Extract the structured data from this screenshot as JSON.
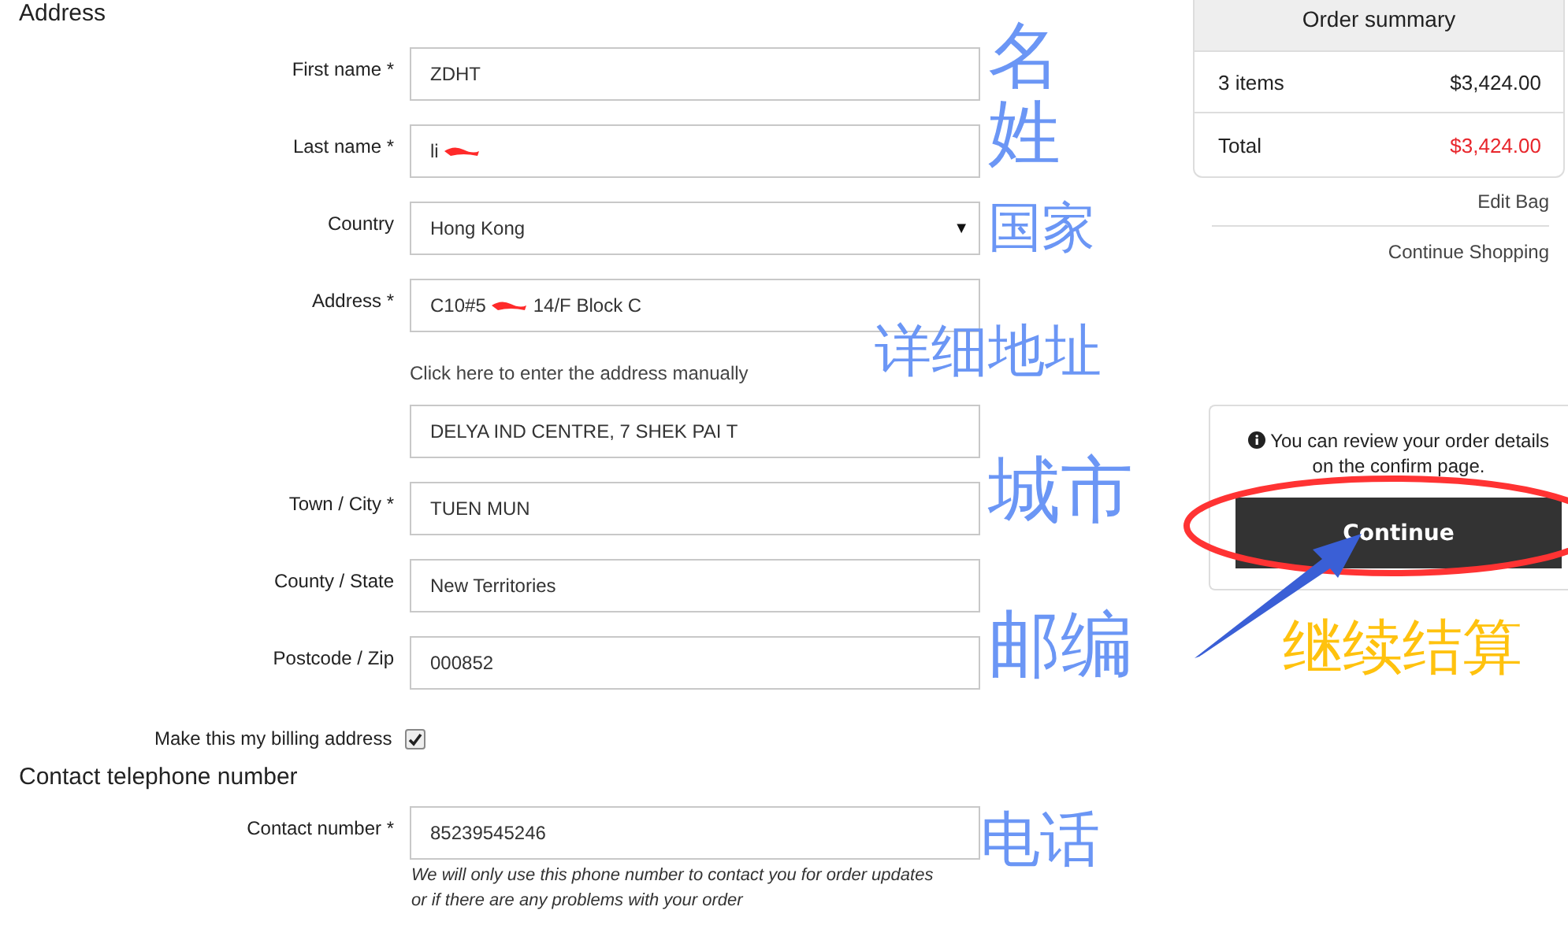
{
  "address_section": {
    "heading": "Address",
    "rows": [
      {
        "kind": "input",
        "label": "First name *",
        "segments": [
          {
            "kind": "text",
            "text": "ZDHT"
          }
        ],
        "note": "名"
      },
      {
        "kind": "input",
        "label": "Last name *",
        "segments": [
          {
            "kind": "text",
            "text": "li"
          },
          {
            "kind": "redaction"
          }
        ],
        "note": "姓"
      },
      {
        "kind": "select",
        "label": "Country",
        "segments": [
          {
            "kind": "text",
            "text": "Hong Kong"
          }
        ],
        "caret": "▼",
        "note": "国家"
      },
      {
        "kind": "input",
        "label": "Address *",
        "segments": [
          {
            "kind": "text",
            "text": "C10#5"
          },
          {
            "kind": "redaction"
          },
          {
            "kind": "text",
            "text": "14/F Block C"
          }
        ]
      },
      {
        "kind": "link",
        "text": "Click here to enter the address manually",
        "note": "详细地址"
      },
      {
        "kind": "input",
        "label": "",
        "segments": [
          {
            "kind": "text",
            "text": "DELYA IND CENTRE, 7 SHEK PAI T"
          }
        ]
      },
      {
        "kind": "input",
        "label": "Town / City *",
        "segments": [
          {
            "kind": "text",
            "text": "TUEN MUN"
          }
        ],
        "note": "城市"
      },
      {
        "kind": "input",
        "label": "County / State",
        "segments": [
          {
            "kind": "text",
            "text": "New Territories"
          }
        ]
      },
      {
        "kind": "input",
        "label": "Postcode / Zip",
        "segments": [
          {
            "kind": "text",
            "text": "000852"
          }
        ],
        "note": "邮编"
      },
      {
        "kind": "checkbox",
        "label": "Make this my billing address",
        "checked": true
      }
    ]
  },
  "contact_section": {
    "heading": "Contact telephone number",
    "label": "Contact number *",
    "value": "85239545246",
    "note": "电话",
    "help": "We will only use this phone number to contact you for order updates or if there are any problems with your order"
  },
  "order_summary": {
    "title": "Order summary",
    "rows": [
      {
        "kind": "subtotal",
        "label": "3 items",
        "amount": "$3,424.00"
      },
      {
        "kind": "total",
        "label": "Total",
        "amount": "$3,424.00"
      }
    ]
  },
  "links": [
    "Edit Bag",
    "Continue Shopping"
  ],
  "checkout": {
    "info": "You can review your order details on the confirm page.",
    "button": "Continue",
    "callout": "继续结算"
  }
}
